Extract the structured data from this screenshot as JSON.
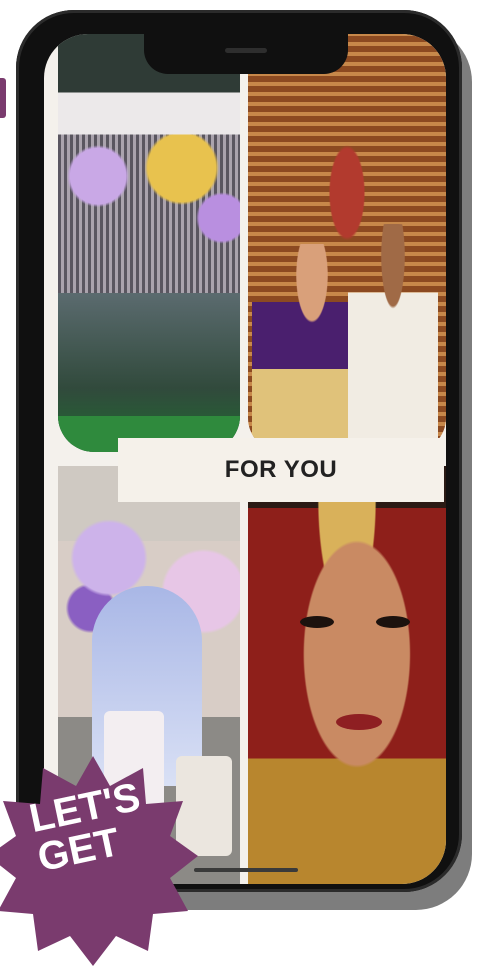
{
  "screen": {
    "section_label": "FOR YOU"
  },
  "tiles": [
    {
      "id": "birthday-party-decor"
    },
    {
      "id": "wedding-couple"
    },
    {
      "id": "butterfly-birthday-setup"
    },
    {
      "id": "bridal-portrait"
    }
  ],
  "promo_badge": {
    "text": "LET'S\nGET",
    "color": "#7a3b6e"
  },
  "colors": {
    "phone_frame": "#101010",
    "label_background": "#f5f1ea",
    "accent": "#7a3b6e"
  }
}
